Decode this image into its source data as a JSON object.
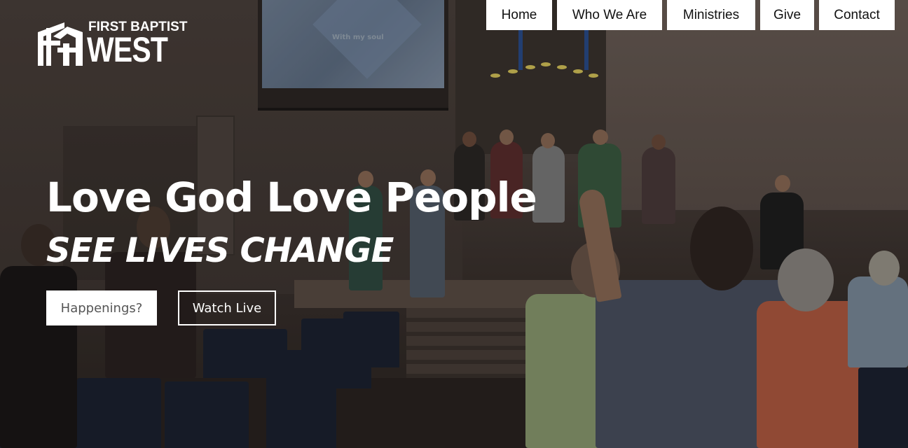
{
  "logo": {
    "line1": "FIRST BAPTIST",
    "line2": "WEST"
  },
  "nav": {
    "items": [
      {
        "label": "Home"
      },
      {
        "label": "Who We Are"
      },
      {
        "label": "Ministries"
      },
      {
        "label": "Give"
      },
      {
        "label": "Contact"
      }
    ]
  },
  "hero": {
    "headline": "Love God Love People",
    "subheadline": "SEE LIVES CHANGE",
    "screen_text": "With my soul",
    "buttons": {
      "happenings": "Happenings?",
      "watch_live": "Watch Live"
    }
  },
  "colors": {
    "nav_bg": "#ffffff",
    "nav_text": "#111111",
    "hero_text": "#ffffff",
    "primary_button_bg": "#ffffff",
    "primary_button_text": "#555555"
  }
}
